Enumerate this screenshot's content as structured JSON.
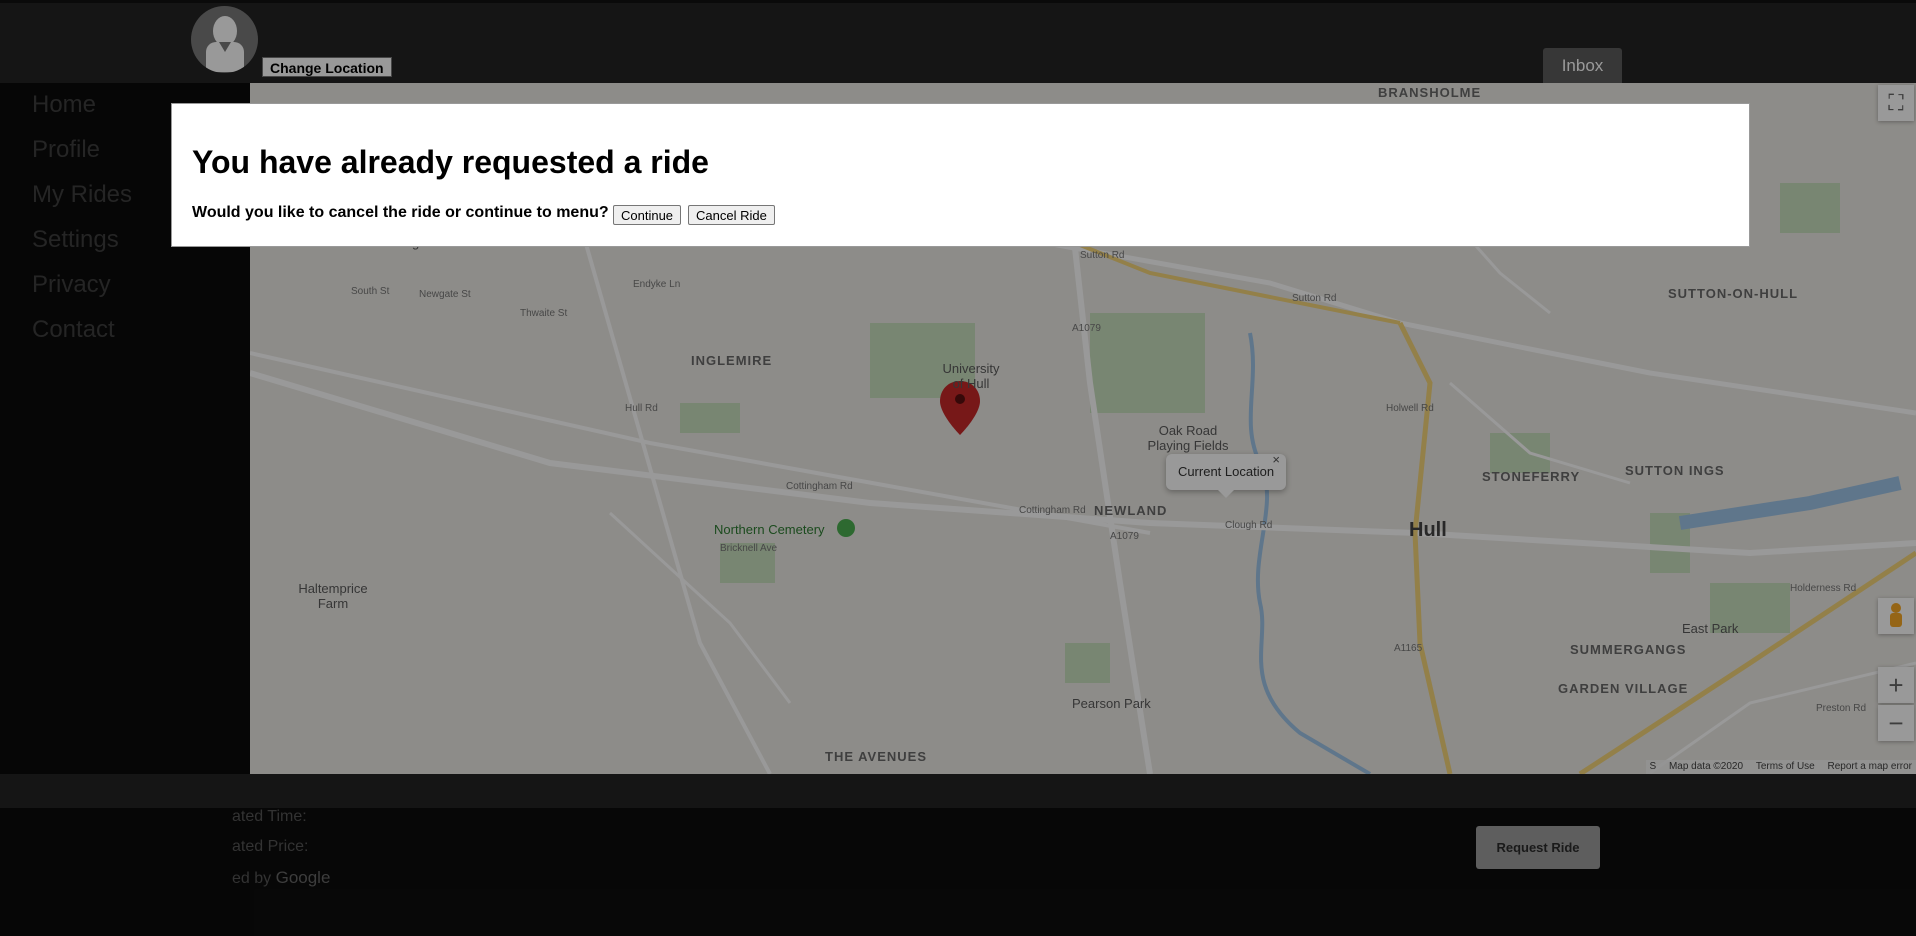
{
  "header": {
    "change_location_label": "Change Location",
    "inbox_label": "Inbox"
  },
  "sidebar": {
    "items": [
      {
        "label": "Home"
      },
      {
        "label": "Profile"
      },
      {
        "label": "My Rides"
      },
      {
        "label": "Settings"
      },
      {
        "label": "Privacy"
      },
      {
        "label": "Contact"
      }
    ]
  },
  "map": {
    "labels": {
      "bransholme": "BRANSHOLME",
      "cottingham": "Cottingham",
      "sutton_on_hull": "SUTTON-ON-HULL",
      "inglemire": "INGLEMIRE",
      "university": "University of Hull",
      "oak_road": "Oak Road Playing Fields",
      "stoneferry": "STONEFERRY",
      "sutton_ings": "SUTTON INGS",
      "newland": "NEWLAND",
      "hull": "Hull",
      "northern_cemetery": "Northern Cemetery",
      "haltemprice": "Haltemprice Farm",
      "east_park": "East Park",
      "summergangs": "SUMMERGANGS",
      "garden_village": "GARDEN VILLAGE",
      "pearson_park": "Pearson Park",
      "the_avenues": "THE AVENUES",
      "sutton_rd": "Sutton Rd",
      "cottingham_rd": "Cottingham Rd",
      "clough_rd": "Clough Rd",
      "endyke_ln": "Endyke Ln",
      "south_st": "South St",
      "newgate_st": "Newgate St",
      "thwaite_st": "Thwaite St",
      "hull_rd": "Hull Rd",
      "holwell_rd": "Holwell Rd",
      "holderness_rd": "Holderness Rd",
      "a1079": "A1079",
      "a1165": "A1165",
      "bricknell_ave": "Bricknell Ave",
      "preston_rd": "Preston Rd"
    },
    "info_window": "Current Location",
    "info_close": "×",
    "attribution": {
      "prefix": "S",
      "map_data": "Map data ©2020",
      "terms": "Terms of Use",
      "report": "Report a map error"
    },
    "zoom_in": "+",
    "zoom_out": "−"
  },
  "footer": {
    "estimated_time": "ated Time:",
    "estimated_price": "ated Price:",
    "powered_by_prefix": "ed by",
    "powered_by_brand": "Google",
    "request_ride_label": "Request Ride"
  },
  "modal": {
    "title": "You have already requested a ride",
    "question": "Would you like to cancel the ride or continue to menu?",
    "continue_label": "Continue",
    "cancel_label": "Cancel Ride"
  }
}
